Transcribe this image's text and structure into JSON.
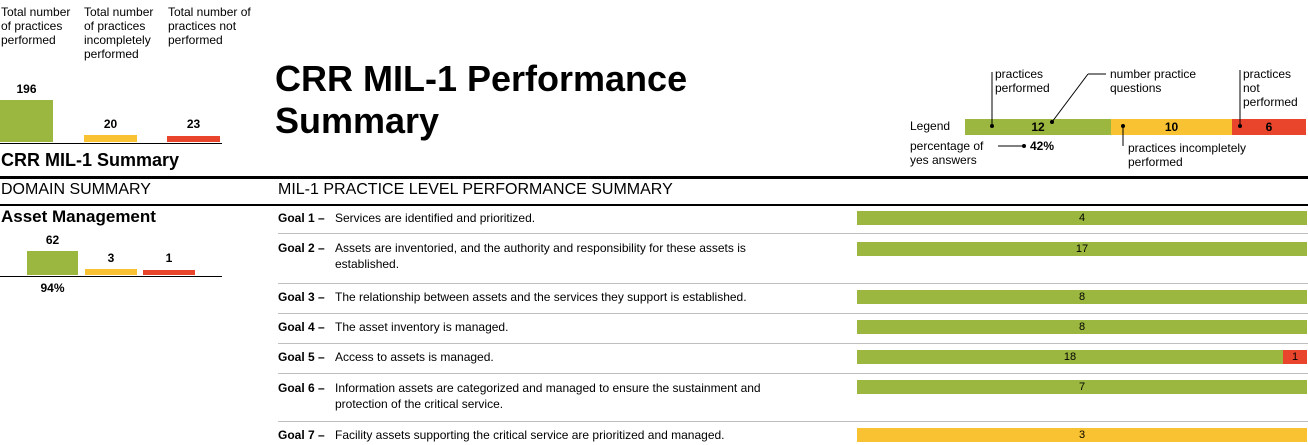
{
  "summary_headers": {
    "performed": "Total number of practices performed",
    "incomplete": "Total number of practices incompletely performed",
    "not_performed": "Total number of practices not performed"
  },
  "summary_values": {
    "performed": "196",
    "incomplete": "20",
    "not_performed": "23"
  },
  "summary_label": "CRR MIL-1 Summary",
  "page_title": "CRR MIL-1 Performance Summary",
  "legend": {
    "label": "Legend",
    "performed_label": "practices performed",
    "questions_label": "number practice questions",
    "not_performed_label": "practices not performed",
    "incomplete_label": "practices incompletely performed",
    "percentage_label": "percentage of yes answers",
    "percentage_value": "42%",
    "values": {
      "performed": "12",
      "incomplete": "10",
      "not_performed": "6"
    }
  },
  "domain_summary_heading": "DOMAIN SUMMARY",
  "practice_summary_heading": "MIL-1 PRACTICE LEVEL PERFORMANCE SUMMARY",
  "domain": {
    "name": "Asset Management",
    "performed": "62",
    "incomplete": "3",
    "not_performed": "1",
    "percentage": "94%"
  },
  "goals": [
    {
      "label": "Goal 1 –",
      "text": "Services are identified and prioritized.",
      "performed": 4,
      "incomplete": 0,
      "not_performed": 0
    },
    {
      "label": "Goal 2 –",
      "text": "Assets are inventoried, and the authority and responsibility for these assets is established.",
      "performed": 17,
      "incomplete": 0,
      "not_performed": 0
    },
    {
      "label": "Goal 3 –",
      "text": "The relationship between assets and the services they support is established.",
      "performed": 8,
      "incomplete": 0,
      "not_performed": 0
    },
    {
      "label": "Goal 4 –",
      "text": "The asset inventory is managed.",
      "performed": 8,
      "incomplete": 0,
      "not_performed": 0
    },
    {
      "label": "Goal 5 –",
      "text": "Access to assets is managed.",
      "performed": 18,
      "incomplete": 0,
      "not_performed": 1
    },
    {
      "label": "Goal 6 –",
      "text": "Information assets are categorized and managed to ensure the sustainment and protection of the critical service.",
      "performed": 7,
      "incomplete": 0,
      "not_performed": 0
    },
    {
      "label": "Goal 7 –",
      "text": "Facility assets supporting the critical service are prioritized and managed.",
      "performed": 0,
      "incomplete": 3,
      "not_performed": 0
    }
  ],
  "colors": {
    "performed": "#9bb73f",
    "incomplete": "#f9c232",
    "not_performed": "#e8452c"
  }
}
